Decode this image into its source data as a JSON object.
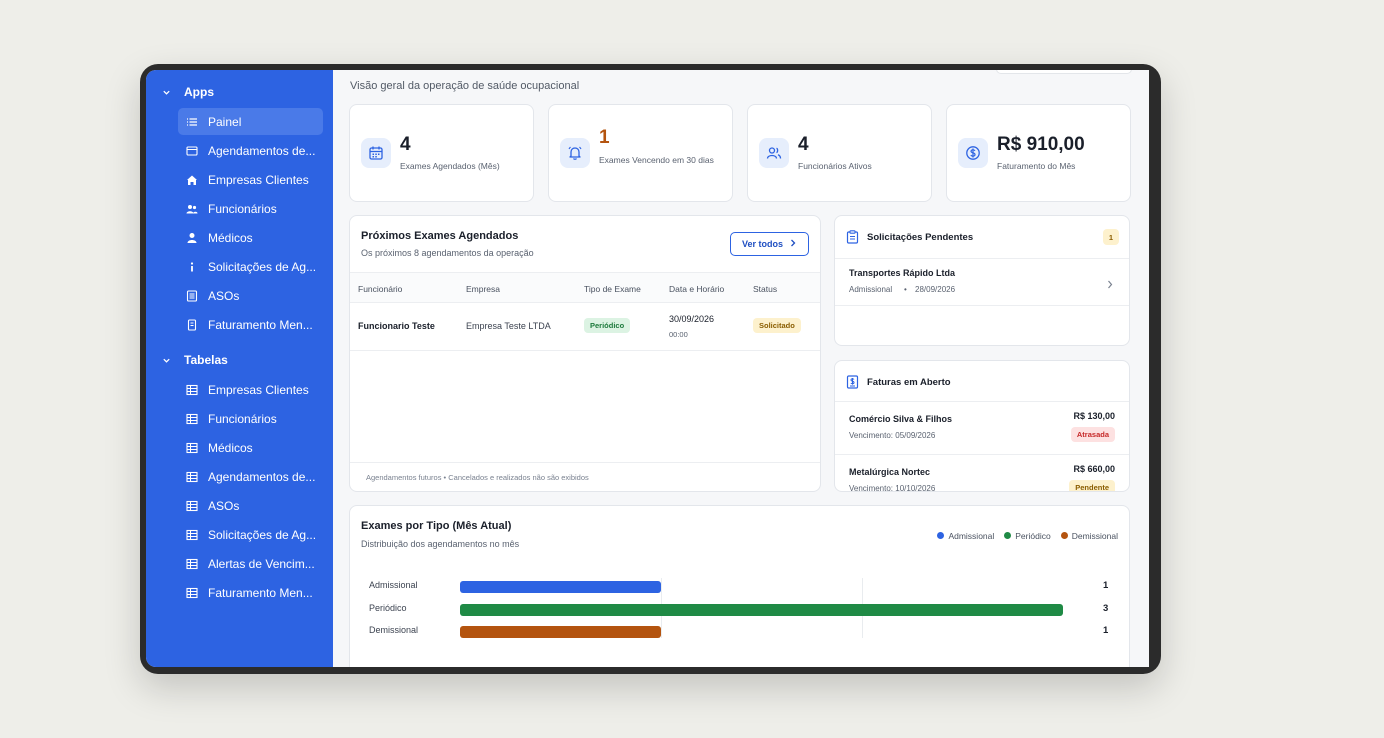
{
  "sidebar": {
    "groups": [
      {
        "title": "Apps",
        "items": [
          {
            "label": "Painel",
            "icon": "list-icon",
            "active": true
          },
          {
            "label": "Agendamentos de...",
            "icon": "window-icon"
          },
          {
            "label": "Empresas Clientes",
            "icon": "home-icon"
          },
          {
            "label": "Funcionários",
            "icon": "users-icon"
          },
          {
            "label": "Médicos",
            "icon": "user-icon"
          },
          {
            "label": "Solicitações de Ag...",
            "icon": "info-icon"
          },
          {
            "label": "ASOs",
            "icon": "document-icon"
          },
          {
            "label": "Faturamento Men...",
            "icon": "receipt-icon"
          }
        ]
      },
      {
        "title": "Tabelas",
        "items": [
          {
            "label": "Empresas Clientes",
            "icon": "table-icon"
          },
          {
            "label": "Funcionários",
            "icon": "table-icon"
          },
          {
            "label": "Médicos",
            "icon": "table-icon"
          },
          {
            "label": "Agendamentos de...",
            "icon": "table-icon"
          },
          {
            "label": "ASOs",
            "icon": "table-icon"
          },
          {
            "label": "Solicitações de Ag...",
            "icon": "table-icon"
          },
          {
            "label": "Alertas de Vencim...",
            "icon": "table-icon"
          },
          {
            "label": "Faturamento Men...",
            "icon": "table-icon"
          }
        ]
      }
    ]
  },
  "header": {
    "subtitle": "Visão geral da operação de saúde ocupacional"
  },
  "stats": [
    {
      "value": "4",
      "label": "Exames Agendados (Mês)",
      "icon": "calendar-icon"
    },
    {
      "value": "1",
      "label": "Exames Vencendo em 30 dias",
      "icon": "bell-icon",
      "color": "#b4540f"
    },
    {
      "value": "4",
      "label": "Funcionários Ativos",
      "icon": "users-icon"
    },
    {
      "value": "R$ 910,00",
      "label": "Faturamento do Mês",
      "icon": "dollar-icon"
    }
  ],
  "upcoming": {
    "title": "Próximos Exames Agendados",
    "subtitle": "Os próximos 8 agendamentos da operação",
    "button": "Ver todos",
    "columns": [
      "Funcionário",
      "Empresa",
      "Tipo de Exame",
      "Data e Horário",
      "Status"
    ],
    "rows": [
      {
        "employee": "Funcionario Teste",
        "company": "Empresa Teste LTDA",
        "type": "Periódico",
        "date": "30/09/2026",
        "time": "00:00",
        "status": "Solicitado"
      }
    ],
    "footer": "Agendamentos futuros • Cancelados e realizados não são exibidos"
  },
  "pending": {
    "title": "Solicitações Pendentes",
    "count": "1",
    "items": [
      {
        "company": "Transportes Rápido Ltda",
        "type": "Admissional",
        "sep": "•",
        "date": "28/09/2026"
      }
    ]
  },
  "invoices": {
    "title": "Faturas em Aberto",
    "items": [
      {
        "company": "Comércio Silva & Filhos",
        "due": "Vencimento: 05/09/2026",
        "amount": "R$ 130,00",
        "status": "Atrasada"
      },
      {
        "company": "Metalúrgica Nortec",
        "due": "Vencimento: 10/10/2026",
        "amount": "R$ 660,00",
        "status": "Pendente"
      }
    ]
  },
  "chart_data": {
    "type": "bar",
    "title": "Exames por Tipo (Mês Atual)",
    "subtitle": "Distribuição dos agendamentos no mês",
    "categories": [
      "Admissional",
      "Periódico",
      "Demissional"
    ],
    "values": [
      1,
      3,
      1
    ],
    "colors": [
      "#2d63e2",
      "#1f8a45",
      "#b4540f"
    ],
    "legend": [
      "Admissional",
      "Periódico",
      "Demissional"
    ],
    "legend_position": "top-right",
    "xlim": [
      0,
      3
    ],
    "grid": true
  }
}
